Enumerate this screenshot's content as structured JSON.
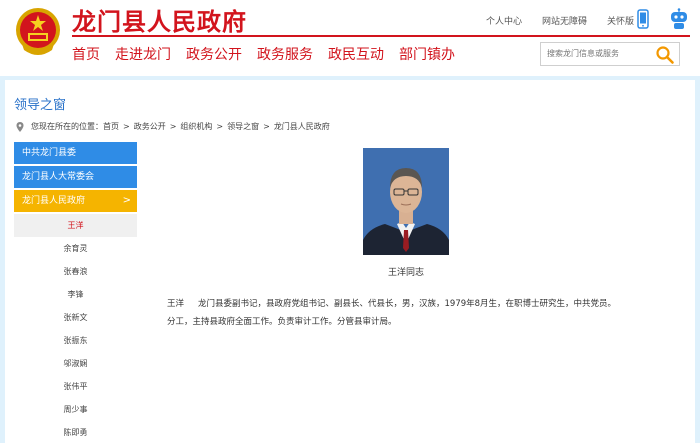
{
  "header": {
    "site_title": "龙门县人民政府",
    "top_links": [
      "个人中心",
      "网站无障碍",
      "关怀版"
    ],
    "nav": [
      "首页",
      "走进龙门",
      "政务公开",
      "政务服务",
      "政民互动",
      "部门镇办"
    ],
    "search_placeholder": "搜索龙门信息或服务",
    "colors": {
      "brand_red": "#d2141d",
      "accent_blue": "#2f8ce6",
      "active_yellow": "#f5b400"
    }
  },
  "page": {
    "section_title": "领导之窗",
    "breadcrumb": {
      "prefix": "您现在所在的位置：",
      "items": [
        "首页",
        "政务公开",
        "组织机构",
        "领导之窗",
        "龙门县人民政府"
      ]
    }
  },
  "sidebar": {
    "groups": [
      {
        "label": "中共龙门县委"
      },
      {
        "label": "龙门县人大常委会"
      },
      {
        "label": "龙门县人民政府",
        "active": true
      }
    ],
    "active_arrow": ">",
    "members": [
      "王洋",
      "余育灵",
      "张春浪",
      "李锋",
      "张新文",
      "张振东",
      "邬淑娴",
      "张伟平",
      "周少事",
      "陈即勇"
    ]
  },
  "profile": {
    "caption": "王洋同志",
    "name": "王洋",
    "line1": "龙门县委副书记，县政府党组书记、副县长、代县长，男，汉族，1979年8月生，在职博士研究生，中共党员。",
    "line2": "分工，主持县政府全面工作。负责审计工作。分管县审计局。"
  }
}
